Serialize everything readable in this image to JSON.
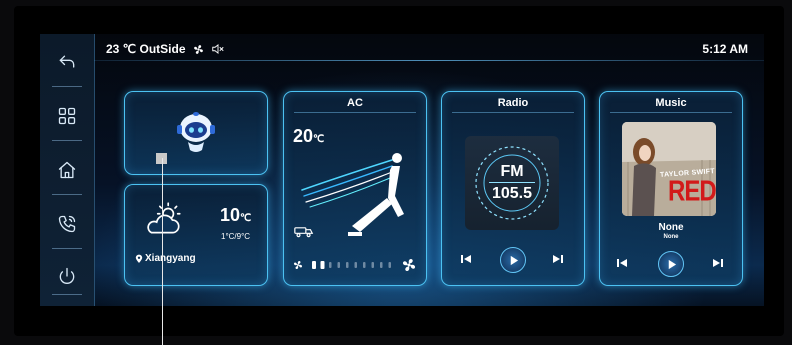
{
  "status": {
    "outside_temp": "23 ℃ OutSide",
    "time": "5:12 AM"
  },
  "sidebar": {
    "items": [
      {
        "name": "back",
        "icon": "back-arrow-icon"
      },
      {
        "name": "apps",
        "icon": "grid-icon"
      },
      {
        "name": "home",
        "icon": "home-icon"
      },
      {
        "name": "phone",
        "icon": "phone-icon"
      },
      {
        "name": "power",
        "icon": "power-icon"
      }
    ]
  },
  "weather": {
    "temp": "10",
    "temp_unit": "℃",
    "range": "1°C/9°C",
    "location": "Xiangyang",
    "icon": "partly-cloudy-icon"
  },
  "ac": {
    "title": "AC",
    "temp": "20",
    "temp_unit": "℃",
    "fan_level": 0.2
  },
  "radio": {
    "title": "Radio",
    "band": "FM",
    "frequency": "105.5"
  },
  "music": {
    "title": "Music",
    "track": "None",
    "artist": "None",
    "album_art_text": "TAYLOR SWIFT",
    "album_art_title": "RED"
  },
  "colors": {
    "accent": "#4cc2f2",
    "background": "#061226"
  }
}
